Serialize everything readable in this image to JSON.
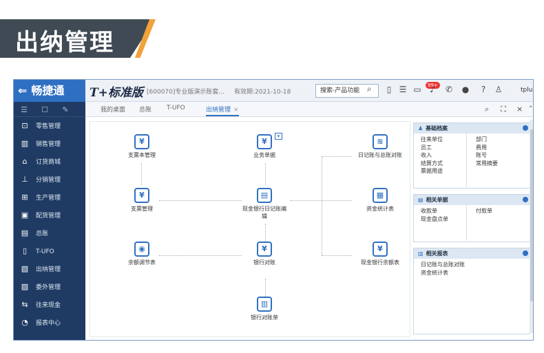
{
  "banner": {
    "title": "出纳管理"
  },
  "app": {
    "brand": "畅捷通",
    "product": "T+标准版",
    "account": "[600070]专业版演示账套...",
    "expiry": "有效期:2021-10-18",
    "search_placeholder": "搜索-产品功能",
    "notification_badge": "99+",
    "user": "tplus..."
  },
  "sidebar": {
    "items": [
      {
        "label": "零售管理"
      },
      {
        "label": "销售管理"
      },
      {
        "label": "订货商城"
      },
      {
        "label": "分销管理"
      },
      {
        "label": "生产管理"
      },
      {
        "label": "配货管理"
      },
      {
        "label": "总账"
      },
      {
        "label": "T-UFO"
      },
      {
        "label": "出纳管理"
      },
      {
        "label": "委外管理"
      },
      {
        "label": "往来现金"
      },
      {
        "label": "报表中心"
      }
    ]
  },
  "tabs": [
    {
      "label": "我的桌面"
    },
    {
      "label": "总账"
    },
    {
      "label": "T-UFO"
    },
    {
      "label": "出纳管理"
    }
  ],
  "flow": {
    "nodes": {
      "check_book": "支票本管理",
      "business_doc": "业务单据",
      "journal_gl": "日记账与总账对账",
      "check_mgmt": "支票管理",
      "journal_edit": "现金银行日记账编辑",
      "fund_stats": "资金统计表",
      "balance_adj": "余额调节表",
      "bank_recon": "银行对账",
      "cash_balance": "现金银行余额表",
      "bank_statement": "银行对账单"
    }
  },
  "panels": {
    "basic": {
      "title": "基础档案",
      "left": [
        "往来单位",
        "员工",
        "收入",
        "结算方式",
        "票据用途"
      ],
      "right": [
        "部门",
        "费用",
        "账号",
        "常用摘要"
      ]
    },
    "docs": {
      "title": "相关单据",
      "left": [
        "收款单",
        "现金盘点单"
      ],
      "right": [
        "付款单"
      ]
    },
    "reports": {
      "title": "相关报表",
      "left": [
        "日记账与总账对账",
        "资金统计表"
      ]
    }
  },
  "colors": {
    "brand": "#2f6fc2",
    "sidebar": "#1f3b63",
    "banner": "#3f4a54",
    "accent": "#f2a23a"
  }
}
